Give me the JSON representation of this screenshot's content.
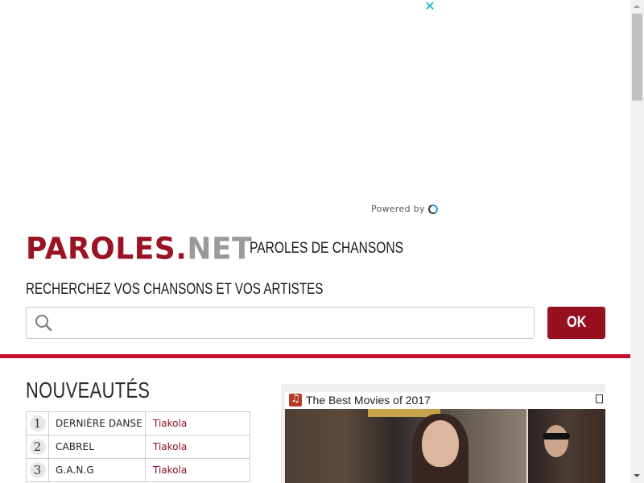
{
  "ad": {
    "close_glyph": "✕",
    "powered_by": "Powered by"
  },
  "header": {
    "logo": {
      "word": "PAROLES",
      "dot": ".",
      "tld": "NET"
    },
    "tagline": "PAROLES DE CHANSONS"
  },
  "search": {
    "title": "RECHERCHEZ VOS CHANSONS ET VOS ARTISTES",
    "placeholder": "",
    "value": "",
    "button_label": "OK"
  },
  "new_releases": {
    "title": "NOUVEAUTÉS",
    "rows": [
      {
        "rank": "1",
        "song": "DERNIÈRE DANSE",
        "artist": "Tiakola"
      },
      {
        "rank": "2",
        "song": "CABREL",
        "artist": "Tiakola"
      },
      {
        "rank": "3",
        "song": "G.A.N.G",
        "artist": "Tiakola"
      }
    ]
  },
  "video": {
    "title": "The Best Movies of 2017"
  },
  "colors": {
    "brand_red": "#9a1424",
    "accent_red": "#c8102e",
    "ok_button": "#961020",
    "logo_grey": "#9a9a9a"
  }
}
